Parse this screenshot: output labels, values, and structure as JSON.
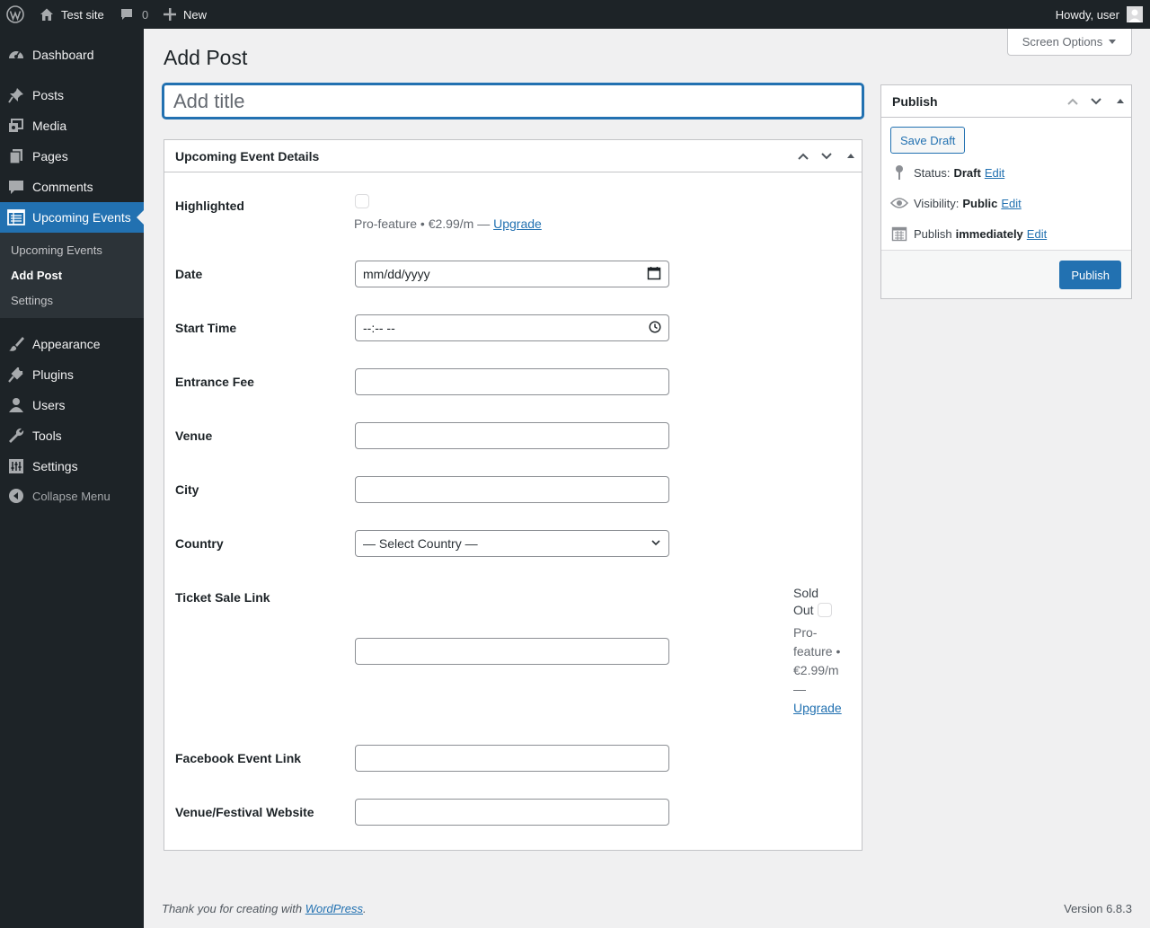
{
  "admin_bar": {
    "site_name": "Test site",
    "comments_count": "0",
    "new_label": "New",
    "howdy": "Howdy, user"
  },
  "sidebar": {
    "items": [
      {
        "label": "Dashboard",
        "icon": "dashboard-icon"
      },
      {
        "label": "Posts",
        "icon": "pin-icon"
      },
      {
        "label": "Media",
        "icon": "media-icon"
      },
      {
        "label": "Pages",
        "icon": "pages-icon"
      },
      {
        "label": "Comments",
        "icon": "comment-icon"
      },
      {
        "label": "Upcoming Events",
        "icon": "calendar-list-icon"
      },
      {
        "label": "Appearance",
        "icon": "brush-icon"
      },
      {
        "label": "Plugins",
        "icon": "plug-icon"
      },
      {
        "label": "Users",
        "icon": "user-icon"
      },
      {
        "label": "Tools",
        "icon": "wrench-icon"
      },
      {
        "label": "Settings",
        "icon": "settings-icon"
      }
    ],
    "submenu": [
      "Upcoming Events",
      "Add Post",
      "Settings"
    ],
    "collapse": "Collapse Menu"
  },
  "screen_options": "Screen Options",
  "page_title": "Add Post",
  "title_placeholder": "Add title",
  "event_box": {
    "title": "Upcoming Event Details",
    "fields": {
      "highlighted": "Highlighted",
      "pro_note": "Pro-feature • €2.99/m — ",
      "upgrade": "Upgrade",
      "date": "Date",
      "date_placeholder": "mm/dd/yyyy",
      "start_time": "Start Time",
      "time_placeholder": "--:-- --",
      "entrance_fee": "Entrance Fee",
      "venue": "Venue",
      "city": "City",
      "country": "Country",
      "country_select": "— Select Country —",
      "ticket_link": "Ticket Sale Link",
      "sold_out_1": "Sold",
      "sold_out_2": "Out",
      "pro_lines": [
        "Pro-",
        "feature •",
        "€2.99/m",
        "—"
      ],
      "facebook": "Facebook Event Link",
      "website": "Venue/Festival Website"
    }
  },
  "publish_box": {
    "title": "Publish",
    "save_draft": "Save Draft",
    "status_label": "Status:",
    "status_value": "Draft",
    "visibility_label": "Visibility:",
    "visibility_value": "Public",
    "publish_label": "Publish",
    "publish_value": "immediately",
    "edit": "Edit",
    "publish_button": "Publish"
  },
  "footer": {
    "thanks_prefix": "Thank you for creating with ",
    "wordpress": "WordPress",
    "suffix": ".",
    "version": "Version 6.8.3"
  }
}
